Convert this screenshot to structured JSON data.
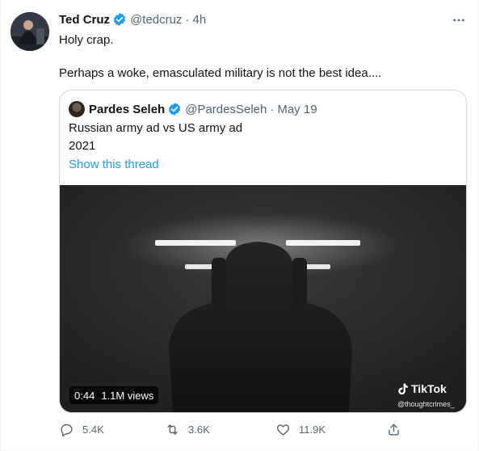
{
  "tweet": {
    "author_name": "Ted Cruz",
    "handle": "@tedcruz",
    "separator": "·",
    "time": "4h",
    "line1": "Holy crap.",
    "line2": "Perhaps a woke, emasculated military is not the best idea...."
  },
  "quote": {
    "author_name": "Pardes Seleh",
    "handle": "@PardesSeleh",
    "separator": "·",
    "date": "May 19",
    "line1": "Russian army ad vs US army ad",
    "line2": "2021",
    "show_thread": "Show this thread",
    "video": {
      "duration": "0:44",
      "views": "1.1M views",
      "watermark": "TikTok",
      "watermark_handle": "@thoughtcrimes_"
    }
  },
  "actions": {
    "replies": "5.4K",
    "retweets": "3.6K",
    "likes": "11.9K"
  },
  "colors": {
    "verified": "#1d9bf0",
    "link": "#1d9bf0",
    "secondary_text": "#536471",
    "border": "#cfd9de"
  },
  "icons": [
    "more-icon",
    "verified-icon",
    "reply-icon",
    "retweet-icon",
    "like-icon",
    "share-icon",
    "tiktok-icon"
  ]
}
